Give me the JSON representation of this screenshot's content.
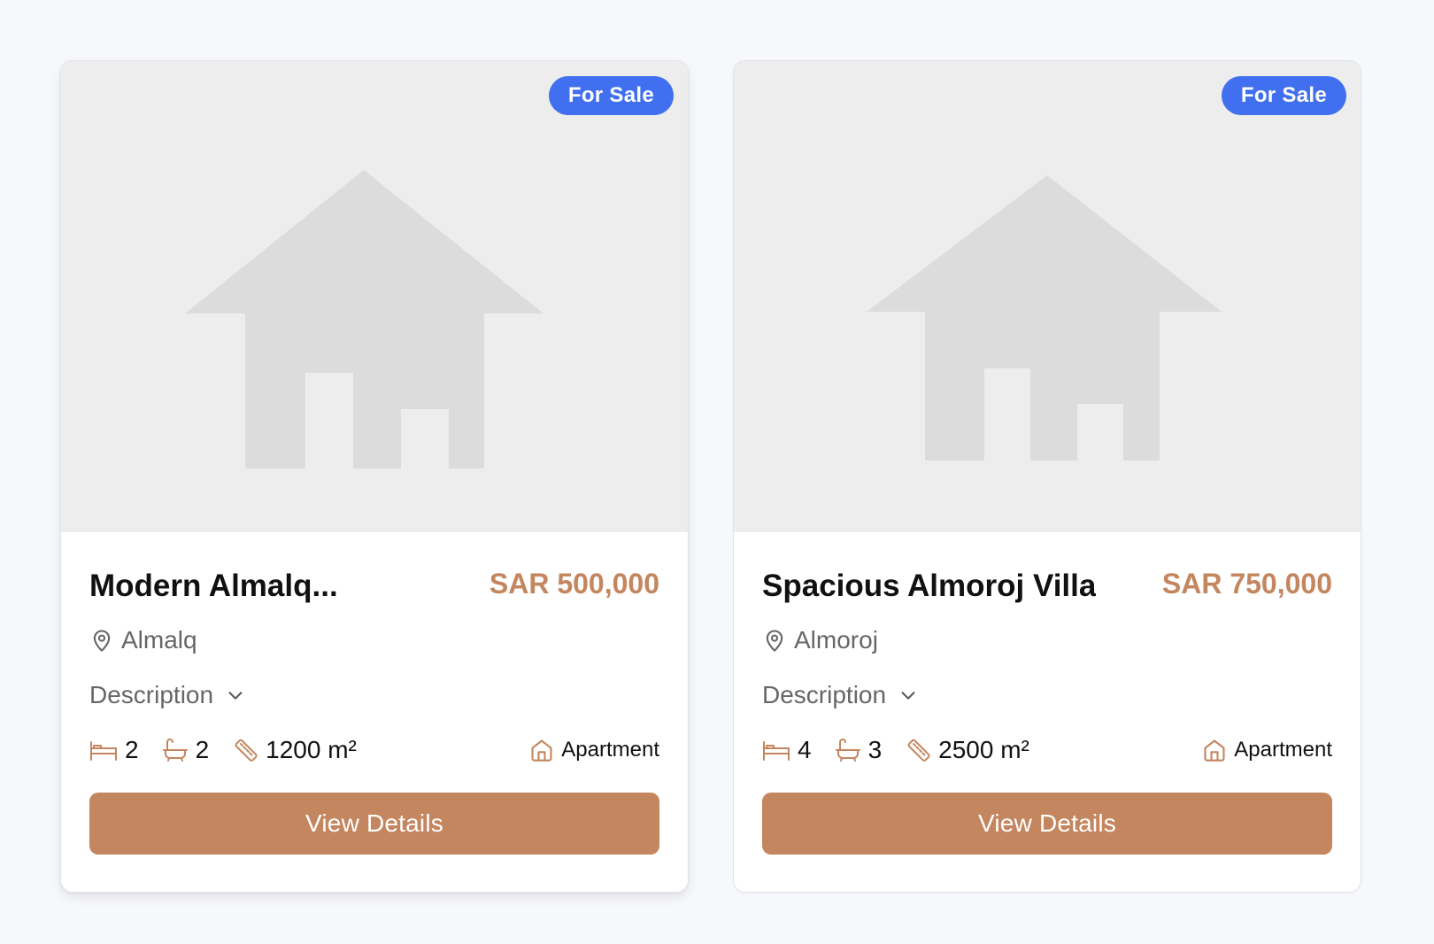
{
  "accent_color": "#c4865f",
  "badge_color": "#4070f0",
  "listings": [
    {
      "badge": "For Sale",
      "title": "Modern Almalq...",
      "price": "SAR 500,000",
      "location": "Almalq",
      "description_label": "Description",
      "bedrooms": "2",
      "bathrooms": "2",
      "area": "1200 m²",
      "type": "Apartment",
      "cta": "View Details"
    },
    {
      "badge": "For Sale",
      "title": "Spacious Almoroj Villa",
      "price": "SAR 750,000",
      "location": "Almoroj",
      "description_label": "Description",
      "bedrooms": "4",
      "bathrooms": "3",
      "area": "2500 m²",
      "type": "Apartment",
      "cta": "View Details"
    }
  ]
}
